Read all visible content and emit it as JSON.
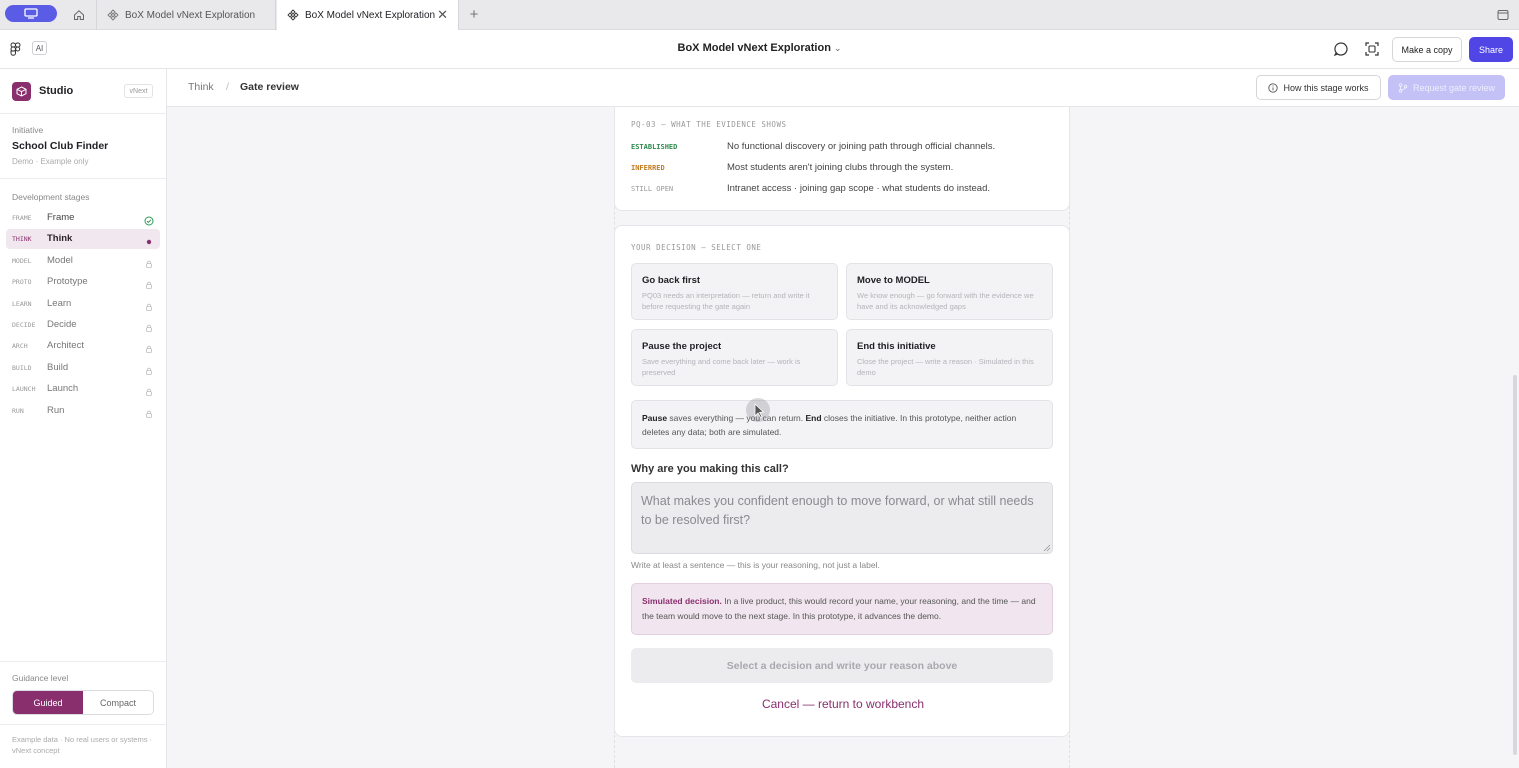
{
  "browser": {
    "tabs": [
      {
        "label": "BoX Model vNext Exploration",
        "active": false
      },
      {
        "label": "BoX Model vNext Exploration",
        "active": true
      }
    ]
  },
  "header": {
    "ai_badge": "AI",
    "title": "BoX Model vNext Exploration",
    "make_copy": "Make a copy",
    "share": "Share",
    "accent_color": "#4f46e5"
  },
  "sidebar": {
    "studio": "Studio",
    "studio_badge": "vNext",
    "initiative_label": "Initiative",
    "initiative_name": "School Club Finder",
    "initiative_sub": "Demo · Example only",
    "stages_label": "Development stages",
    "stages": [
      {
        "code": "FRAME",
        "name": "Frame",
        "status": "done"
      },
      {
        "code": "THINK",
        "name": "Think",
        "status": "active"
      },
      {
        "code": "MODEL",
        "name": "Model",
        "status": "locked"
      },
      {
        "code": "PROTO",
        "name": "Prototype",
        "status": "locked"
      },
      {
        "code": "LEARN",
        "name": "Learn",
        "status": "locked"
      },
      {
        "code": "DECIDE",
        "name": "Decide",
        "status": "locked"
      },
      {
        "code": "ARCH",
        "name": "Architect",
        "status": "locked"
      },
      {
        "code": "BUILD",
        "name": "Build",
        "status": "locked"
      },
      {
        "code": "LAUNCH",
        "name": "Launch",
        "status": "locked"
      },
      {
        "code": "RUN",
        "name": "Run",
        "status": "locked"
      }
    ],
    "guidance_label": "Guidance level",
    "guidance_options": [
      "Guided",
      "Compact"
    ],
    "guidance_selected": "Guided",
    "footer_note": "Example data · No real users or systems · vNext concept",
    "brand_color": "#8a2f6e"
  },
  "breadcrumb": {
    "parent": "Think",
    "separator": "/",
    "current": "Gate review",
    "how_button": "How this stage works",
    "request_button": "Request gate review"
  },
  "evidence": {
    "header": "PQ-03 — WHAT THE EVIDENCE SHOWS",
    "rows": [
      {
        "tag": "ESTABLISHED",
        "text": "No functional discovery or joining path through official channels.",
        "color": "#2f8a4e"
      },
      {
        "tag": "INFERRED",
        "text": "Most students aren't joining clubs through the system.",
        "color": "#c47a1d"
      },
      {
        "tag": "STILL OPEN",
        "text": "Intranet access · joining gap scope · what students do instead.",
        "color": "#999999"
      }
    ]
  },
  "decision": {
    "header": "YOUR DECISION — SELECT ONE",
    "options": [
      {
        "title": "Go back first",
        "desc": "PQ03 needs an interpretation — return and write it before requesting the gate again"
      },
      {
        "title": "Move to MODEL",
        "desc": "We know enough — go forward with the evidence we have and its acknowledged gaps"
      },
      {
        "title": "Pause the project",
        "desc": "Save everything and come back later — work is preserved"
      },
      {
        "title": "End this initiative",
        "desc": "Close the project — write a reason · Simulated in this demo"
      }
    ],
    "note_pause": "Pause",
    "note_mid": " saves everything — you can return. ",
    "note_end": "End",
    "note_rest": " closes the initiative. In this prototype, neither action deletes any data; both are simulated.",
    "why_label": "Why are you making this call?",
    "why_placeholder": "What makes you confident enough to move forward, or what still needs to be resolved first?",
    "helper": "Write at least a sentence — this is your reasoning, not just a label.",
    "sim_bold": "Simulated decision.",
    "sim_text": " In a live product, this would record your name, your reasoning, and the time — and the team would move to the next stage. In this prototype, it advances the demo.",
    "submit": "Select a decision and write your reason above",
    "cancel": "Cancel — return to workbench"
  }
}
